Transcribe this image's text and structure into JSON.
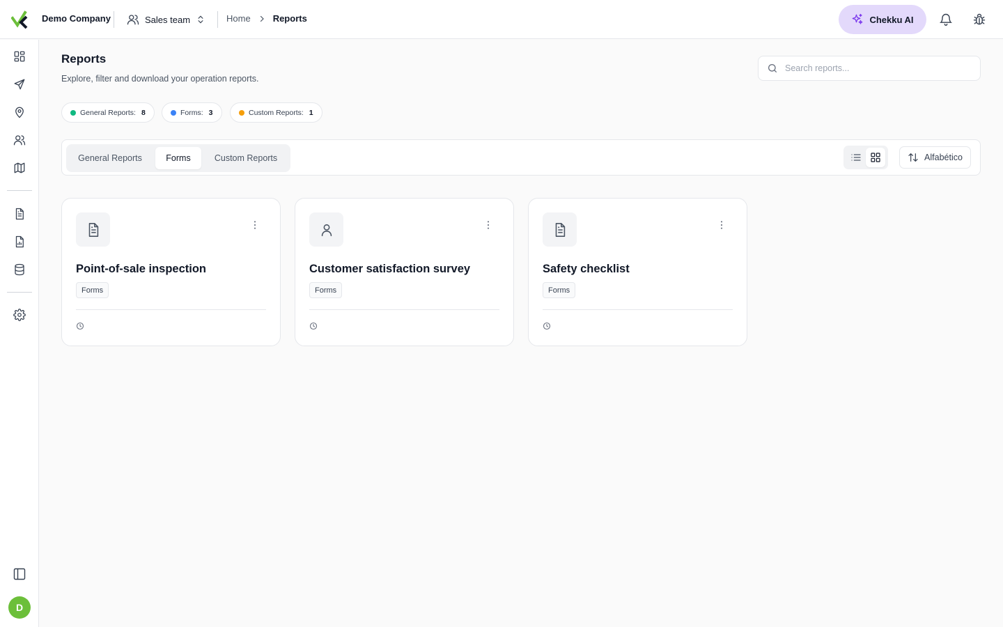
{
  "header": {
    "company": "Demo Company",
    "team": "Sales team",
    "breadcrumb": {
      "home": "Home",
      "current": "Reports"
    },
    "ai_button": "Chekku AI"
  },
  "sidebar": {
    "items": [
      "dashboard-icon",
      "send-icon",
      "location-pin-icon",
      "users-icon",
      "map-icon",
      "document-icon",
      "report-icon",
      "database-icon",
      "gear-icon"
    ],
    "collapse_icon": "sidebar-toggle-icon",
    "avatar_initial": "D"
  },
  "page": {
    "title": "Reports",
    "subtitle": "Explore, filter and download your operation reports.",
    "search_placeholder": "Search reports..."
  },
  "stats": [
    {
      "label": "General Reports:",
      "count": "8",
      "color": "#10b981"
    },
    {
      "label": "Forms:",
      "count": "3",
      "color": "#3b82f6"
    },
    {
      "label": "Custom Reports:",
      "count": "1",
      "color": "#f59e0b"
    }
  ],
  "tabs": [
    {
      "label": "General Reports",
      "active": false
    },
    {
      "label": "Forms",
      "active": true
    },
    {
      "label": "Custom Reports",
      "active": false
    }
  ],
  "view_mode": "grid",
  "sort": {
    "label": "Alfabético"
  },
  "cards": [
    {
      "title": "Point-of-sale inspection",
      "tag": "Forms",
      "icon": "document-icon"
    },
    {
      "title": "Customer satisfaction survey",
      "tag": "Forms",
      "icon": "user-icon"
    },
    {
      "title": "Safety checklist",
      "tag": "Forms",
      "icon": "document-icon"
    }
  ],
  "colors": {
    "accent": "#6cbf3a",
    "ai_button_bg": "#e3d9fb",
    "ai_icon": "#7c3aed"
  }
}
